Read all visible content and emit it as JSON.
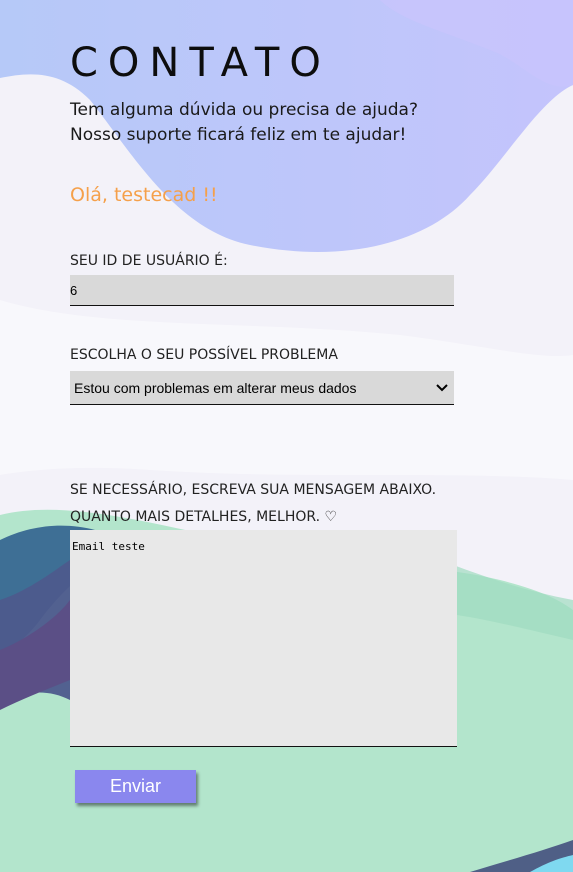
{
  "page": {
    "title": "CONTATO",
    "subtitle_line1": "Tem alguma dúvida ou precisa de ajuda?",
    "subtitle_line2": "Nosso suporte ficará feliz em te ajudar!",
    "greeting": "Olá, testecad !!"
  },
  "form": {
    "user_id_label": "SEU ID DE USUÁRIO É:",
    "user_id_value": "6",
    "problem_label": "ESCOLHA O SEU POSSÍVEL PROBLEMA",
    "problem_selected": "Estou com problemas em alterar meus dados",
    "message_label_line1": "SE NECESSÁRIO, ESCREVA SUA MENSAGEM ABAIXO.",
    "message_label_line2": "QUANTO MAIS DETALHES, MELHOR. ♡",
    "message_value": "Email teste",
    "submit_label": "Enviar"
  },
  "colors": {
    "greeting": "#f5a04a",
    "button": "#8a87ee",
    "field": "#d9d9d9",
    "textarea": "#e8e8e8"
  },
  "icons": {
    "select_arrow": "chevron-down-icon"
  }
}
